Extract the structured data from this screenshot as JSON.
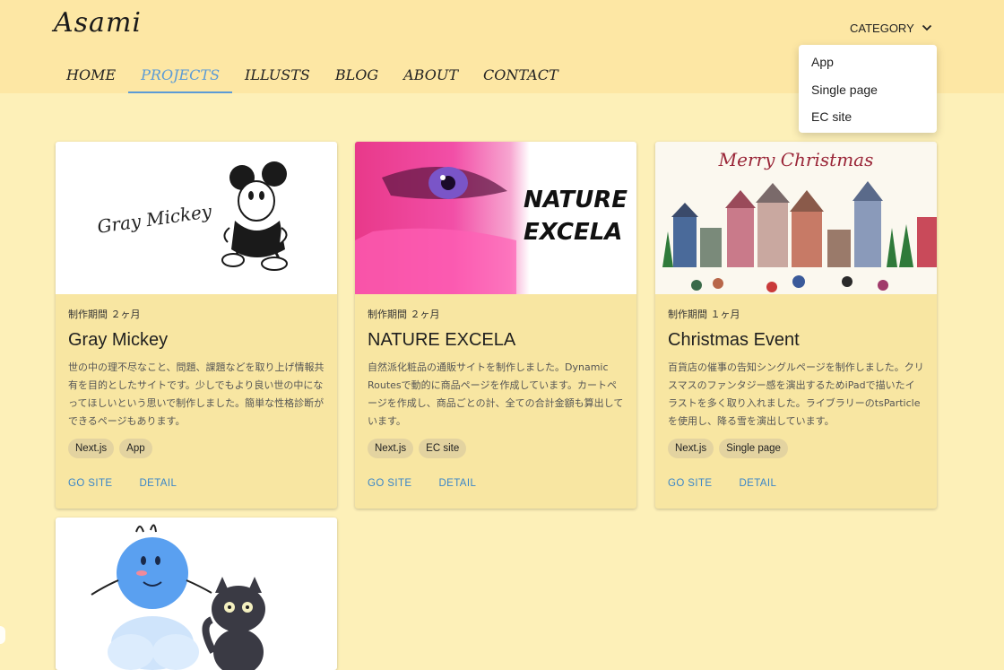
{
  "header": {
    "logo": "Asami",
    "category_label": "CATEGORY",
    "nav": [
      "HOME",
      "PROJECTS",
      "ILLUSTS",
      "BLOG",
      "ABOUT",
      "CONTACT"
    ],
    "active_nav": "PROJECTS"
  },
  "dropdown": {
    "items": [
      "App",
      "Single page",
      "EC site"
    ]
  },
  "cards": [
    {
      "image_text": "Gray Mickey",
      "period": "制作期間 ２ヶ月",
      "title": "Gray Mickey",
      "description": "世の中の理不尽なこと、問題、課題などを取り上げ情報共有を目的としたサイトです。少しでもより良い世の中になってほしいという思いで制作しました。簡単な性格診断ができるページもあります。",
      "tags": [
        "Next.js",
        "App"
      ],
      "go_site": "GO SITE",
      "detail": "DETAIL"
    },
    {
      "image_text_line1": "NATURE",
      "image_text_line2": "EXCELA",
      "period": "制作期間 ２ヶ月",
      "title": "NATURE EXCELA",
      "description": "自然派化粧品の通販サイトを制作しました。Dynamic Routesで動的に商品ページを作成しています。カートページを作成し、商品ごとの計、全ての合計金額も算出しています。",
      "tags": [
        "Next.js",
        "EC site"
      ],
      "go_site": "GO SITE",
      "detail": "DETAIL"
    },
    {
      "image_text": "Merry Christmas",
      "period": "制作期間 １ヶ月",
      "title": "Christmas Event",
      "description": "百貨店の催事の告知シングルページを制作しました。クリスマスのファンタジー感を演出するためiPadで描いたイラストを多く取り入れました。ライブラリーのtsParticleを使用し、降る雪を演出しています。",
      "tags": [
        "Next.js",
        "Single page"
      ],
      "go_site": "GO SITE",
      "detail": "DETAIL"
    }
  ],
  "colors": {
    "page_bg": "#fdf0b8",
    "header_bg": "#fde7a4",
    "card_bg": "#f8e6a2",
    "accent": "#5b9bd6",
    "link": "#3a86c8"
  },
  "icons": {
    "category": "chevron-down-icon"
  }
}
